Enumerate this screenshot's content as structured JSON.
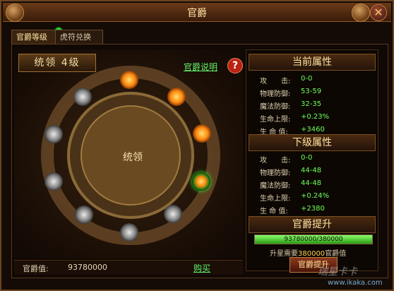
{
  "window": {
    "title": "官爵",
    "close_glyph": "✕"
  },
  "tabs": [
    {
      "label": "官爵等级",
      "active": true,
      "has_notification": true
    },
    {
      "label": "虎符兑换",
      "active": false
    }
  ],
  "rank": {
    "label": "统领 4级",
    "center_label": "统领"
  },
  "links": {
    "explain": "官爵说明",
    "help": "?",
    "buy": "购买"
  },
  "nodes": [
    {
      "type": "gold"
    },
    {
      "type": "gold"
    },
    {
      "type": "gold"
    },
    {
      "type": "current"
    },
    {
      "type": "silver"
    },
    {
      "type": "silver"
    },
    {
      "type": "silver"
    },
    {
      "type": "silver"
    },
    {
      "type": "silver"
    },
    {
      "type": "silver"
    }
  ],
  "current_attributes": {
    "title": "当前属性",
    "rows": [
      {
        "label": "攻　　击:",
        "value": "0-0"
      },
      {
        "label": "物理防御:",
        "value": "53-59"
      },
      {
        "label": "魔法防御:",
        "value": "32-35"
      },
      {
        "label": "生命上限:",
        "value": "+0.23%"
      },
      {
        "label": "生 命 值:",
        "value": "+3460"
      }
    ]
  },
  "next_attributes": {
    "title": "下级属性",
    "rows": [
      {
        "label": "攻　　击:",
        "value": "0-0"
      },
      {
        "label": "物理防御:",
        "value": "44-48"
      },
      {
        "label": "魔法防御:",
        "value": "44-48"
      },
      {
        "label": "生命上限:",
        "value": "+0.24%"
      },
      {
        "label": "生 命 值:",
        "value": "+2380"
      }
    ]
  },
  "promotion": {
    "title": "官爵提升",
    "progress_text": "93780000/380000",
    "progress_fraction": 1.0,
    "need_prefix": "升星需要",
    "need_amount": "380000",
    "need_suffix": "官爵值",
    "button": "官爵提升"
  },
  "footer": {
    "label": "官爵值:",
    "value": "93780000"
  },
  "watermark": {
    "line1": "瑞星卡卡",
    "line2": "www.ikaka.com"
  }
}
